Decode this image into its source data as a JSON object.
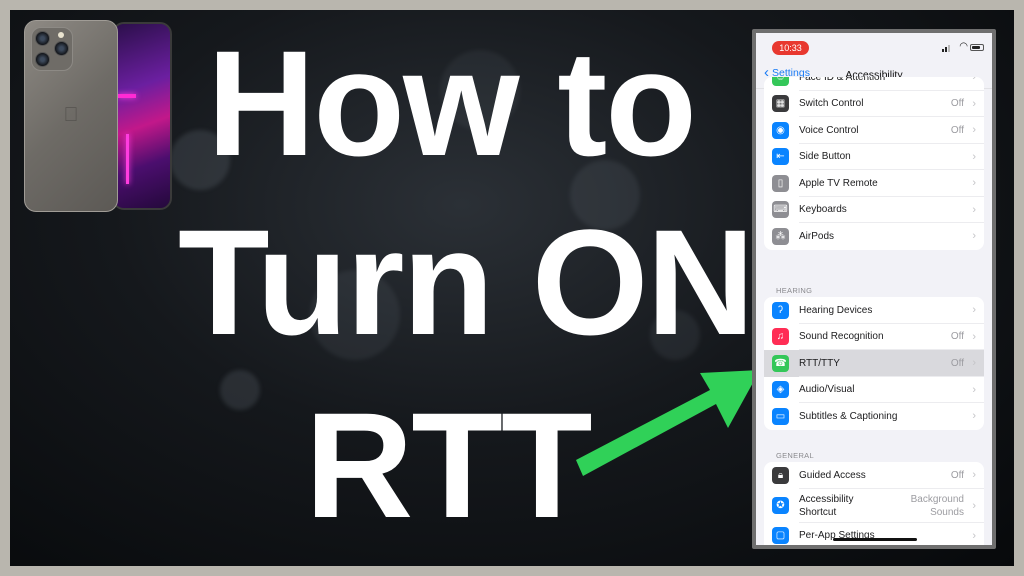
{
  "thumbnail": {
    "title_lines": [
      "How to",
      "Turn ON",
      "RTT"
    ],
    "colors": {
      "arrow": "#30d158",
      "title": "#ffffff",
      "frame": "#b9b6ae"
    }
  },
  "phone": {
    "status_time": "10:33",
    "nav": {
      "back_label": "Settings",
      "title": "Accessibility"
    },
    "groups": [
      {
        "header": "",
        "items": [
          {
            "label": "Face ID & Attention",
            "value": "",
            "icon": "face-id-icon",
            "color": "#34c759",
            "glyph": "☺"
          },
          {
            "label": "Switch Control",
            "value": "Off",
            "icon": "switch-control-icon",
            "color": "#3a3a3c",
            "glyph": "▦"
          },
          {
            "label": "Voice Control",
            "value": "Off",
            "icon": "voice-control-icon",
            "color": "#0a84ff",
            "glyph": "◉"
          },
          {
            "label": "Side Button",
            "value": "",
            "icon": "side-button-icon",
            "color": "#0a84ff",
            "glyph": "⇤"
          },
          {
            "label": "Apple TV Remote",
            "value": "",
            "icon": "tv-remote-icon",
            "color": "#8e8e93",
            "glyph": "▯"
          },
          {
            "label": "Keyboards",
            "value": "",
            "icon": "keyboard-icon",
            "color": "#8e8e93",
            "glyph": "⌨"
          },
          {
            "label": "AirPods",
            "value": "",
            "icon": "airpods-icon",
            "color": "#8e8e93",
            "glyph": "⁂"
          }
        ]
      },
      {
        "header": "HEARING",
        "items": [
          {
            "label": "Hearing Devices",
            "value": "",
            "icon": "ear-icon",
            "color": "#0a84ff",
            "glyph": "ʔ"
          },
          {
            "label": "Sound Recognition",
            "value": "Off",
            "icon": "sound-recognition-icon",
            "color": "#ff2d55",
            "glyph": "♫"
          },
          {
            "label": "RTT/TTY",
            "value": "Off",
            "icon": "rtt-tty-icon",
            "color": "#34c759",
            "glyph": "☎",
            "selected": true
          },
          {
            "label": "Audio/Visual",
            "value": "",
            "icon": "audio-visual-icon",
            "color": "#0a84ff",
            "glyph": "◈"
          },
          {
            "label": "Subtitles & Captioning",
            "value": "",
            "icon": "captions-icon",
            "color": "#0a84ff",
            "glyph": "▭"
          }
        ]
      },
      {
        "header": "GENERAL",
        "items": [
          {
            "label": "Guided Access",
            "value": "Off",
            "icon": "guided-access-icon",
            "color": "#3a3a3c",
            "glyph": "🔒︎"
          },
          {
            "label": "Accessibility Shortcut",
            "label_lines": [
              "Accessibility",
              "Shortcut"
            ],
            "value_lines": [
              "Background",
              "Sounds"
            ],
            "icon": "accessibility-icon",
            "color": "#0a84ff",
            "glyph": "✪"
          },
          {
            "label": "Per-App Settings",
            "value": "",
            "icon": "per-app-icon",
            "color": "#0a84ff",
            "glyph": "▢"
          }
        ]
      }
    ]
  }
}
